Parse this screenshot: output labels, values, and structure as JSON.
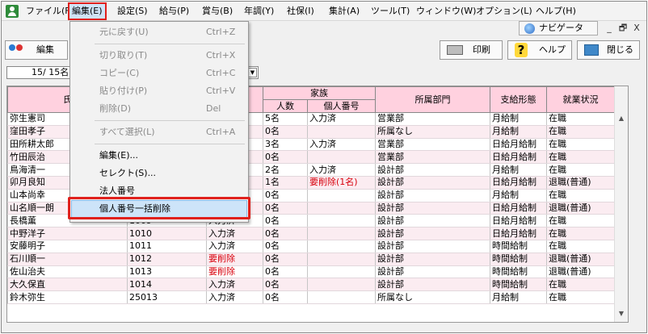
{
  "menubar": {
    "items": [
      {
        "label": "ファイル(F)"
      },
      {
        "label": "編集(E)"
      },
      {
        "label": "設定(S)"
      },
      {
        "label": "給与(P)"
      },
      {
        "label": "賞与(B)"
      },
      {
        "label": "年調(Y)"
      },
      {
        "label": "社保(I)"
      },
      {
        "label": "集計(A)"
      },
      {
        "label": "ツール(T)"
      },
      {
        "label": "ウィンドウ(W)"
      },
      {
        "label": "オプション(L)"
      },
      {
        "label": "ヘルプ(H)"
      }
    ]
  },
  "navigator": {
    "label": "ナビゲータ"
  },
  "window_controls": {
    "minimize": "_",
    "restore": "🗗",
    "close": "X"
  },
  "toolbar": {
    "edit_label": "編集",
    "print_label": "印刷",
    "help_label": "ヘルプ",
    "close_label": "閉じる"
  },
  "filter": {
    "text": "15/  15名"
  },
  "edit_menu": {
    "items": [
      {
        "label": "元に戻す(U)",
        "shortcut": "Ctrl+Z",
        "disabled": true
      },
      {
        "label": "切り取り(T)",
        "shortcut": "Ctrl+X",
        "disabled": true
      },
      {
        "label": "コピー(C)",
        "shortcut": "Ctrl+C",
        "disabled": true
      },
      {
        "label": "貼り付け(P)",
        "shortcut": "Ctrl+V",
        "disabled": true
      },
      {
        "label": "削除(D)",
        "shortcut": "Del",
        "disabled": true
      },
      {
        "label": "すべて選択(L)",
        "shortcut": "Ctrl+A",
        "disabled": true
      },
      {
        "label": "編集(E)...",
        "shortcut": "",
        "disabled": false
      },
      {
        "label": "セレクト(S)...",
        "shortcut": "",
        "disabled": false
      },
      {
        "label": "法人番号",
        "shortcut": "",
        "disabled": false
      },
      {
        "label": "個人番号一括削除",
        "shortcut": "",
        "disabled": false
      }
    ]
  },
  "table": {
    "headers": {
      "name": "氏",
      "code": "",
      "mynumber": "号",
      "family": "家族",
      "family_count": "人数",
      "family_mynumber": "個人番号",
      "department": "所属部門",
      "pay_type": "支給形態",
      "status": "就業状況"
    },
    "rows": [
      {
        "name": "弥生憲司",
        "code": "",
        "mynumber": "",
        "family_count": "5名",
        "family_mynumber": "入力済",
        "fam_red": false,
        "my_red": false,
        "department": "営業部",
        "pay_type": "月給制",
        "status": "在職"
      },
      {
        "name": "窪田孝子",
        "code": "",
        "mynumber": "",
        "family_count": "0名",
        "family_mynumber": "",
        "fam_red": false,
        "my_red": false,
        "department": "所属なし",
        "pay_type": "月給制",
        "status": "在職"
      },
      {
        "name": "田所耕太郎",
        "code": "",
        "mynumber": "",
        "family_count": "3名",
        "family_mynumber": "入力済",
        "fam_red": false,
        "my_red": false,
        "department": "営業部",
        "pay_type": "日給月給制",
        "status": "在職"
      },
      {
        "name": "竹田辰治",
        "code": "",
        "mynumber": "",
        "family_count": "0名",
        "family_mynumber": "",
        "fam_red": false,
        "my_red": false,
        "department": "営業部",
        "pay_type": "日給月給制",
        "status": "在職"
      },
      {
        "name": "鳥海清一",
        "code": "",
        "mynumber": "",
        "family_count": "2名",
        "family_mynumber": "入力済",
        "fam_red": false,
        "my_red": false,
        "department": "設計部",
        "pay_type": "月給制",
        "status": "在職"
      },
      {
        "name": "卯月良知",
        "code": "",
        "mynumber": "",
        "family_count": "1名",
        "family_mynumber": "要削除(1名)",
        "fam_red": true,
        "my_red": false,
        "department": "設計部",
        "pay_type": "日給月給制",
        "status": "退職(普通)"
      },
      {
        "name": "山本尚幸",
        "code": "",
        "mynumber": "",
        "family_count": "0名",
        "family_mynumber": "",
        "fam_red": false,
        "my_red": false,
        "department": "設計部",
        "pay_type": "月給制",
        "status": "在職"
      },
      {
        "name": "山名順一朗",
        "code": "",
        "mynumber": "",
        "family_count": "0名",
        "family_mynumber": "",
        "fam_red": false,
        "my_red": false,
        "department": "設計部",
        "pay_type": "日給月給制",
        "status": "退職(普通)"
      },
      {
        "name": "長橋薫",
        "code": "1009",
        "mynumber": "入力済",
        "family_count": "0名",
        "family_mynumber": "",
        "fam_red": false,
        "my_red": false,
        "department": "設計部",
        "pay_type": "日給月給制",
        "status": "在職"
      },
      {
        "name": "中野洋子",
        "code": "1010",
        "mynumber": "入力済",
        "family_count": "0名",
        "family_mynumber": "",
        "fam_red": false,
        "my_red": false,
        "department": "設計部",
        "pay_type": "日給月給制",
        "status": "在職"
      },
      {
        "name": "安藤明子",
        "code": "1011",
        "mynumber": "入力済",
        "family_count": "0名",
        "family_mynumber": "",
        "fam_red": false,
        "my_red": false,
        "department": "設計部",
        "pay_type": "時間給制",
        "status": "在職"
      },
      {
        "name": "石川順一",
        "code": "1012",
        "mynumber": "要削除",
        "family_count": "0名",
        "family_mynumber": "",
        "fam_red": false,
        "my_red": true,
        "department": "設計部",
        "pay_type": "時間給制",
        "status": "退職(普通)"
      },
      {
        "name": "佐山治夫",
        "code": "1013",
        "mynumber": "要削除",
        "family_count": "0名",
        "family_mynumber": "",
        "fam_red": false,
        "my_red": true,
        "department": "設計部",
        "pay_type": "時間給制",
        "status": "退職(普通)"
      },
      {
        "name": "大久保直",
        "code": "1014",
        "mynumber": "入力済",
        "family_count": "0名",
        "family_mynumber": "",
        "fam_red": false,
        "my_red": false,
        "department": "設計部",
        "pay_type": "時間給制",
        "status": "在職"
      },
      {
        "name": "鈴木弥生",
        "code": "25013",
        "mynumber": "入力済",
        "family_count": "0名",
        "family_mynumber": "",
        "fam_red": false,
        "my_red": false,
        "department": "所属なし",
        "pay_type": "月給制",
        "status": "在職"
      }
    ]
  }
}
